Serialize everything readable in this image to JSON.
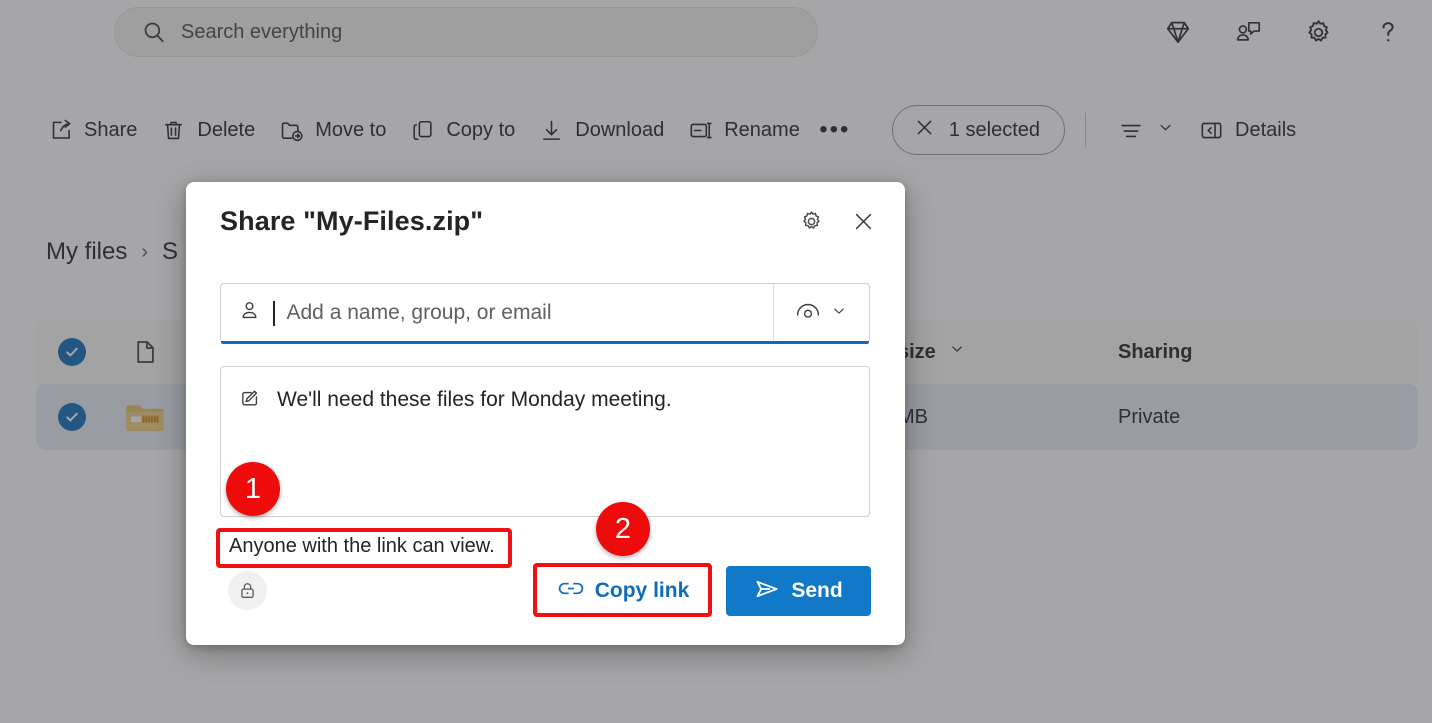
{
  "search": {
    "placeholder": "Search everything",
    "icon": "search-icon"
  },
  "topbar": {
    "icons": [
      {
        "name": "premium-diamond-icon",
        "label": "Premium"
      },
      {
        "name": "feedback-icon",
        "label": "Feedback"
      },
      {
        "name": "settings-gear-icon",
        "label": "Settings"
      },
      {
        "name": "help-question-icon",
        "label": "Help"
      }
    ]
  },
  "toolbar": {
    "commands": [
      {
        "label": "Share",
        "icon": "share-icon"
      },
      {
        "label": "Delete",
        "icon": "trash-icon"
      },
      {
        "label": "Move to",
        "icon": "move-to-folder-icon"
      },
      {
        "label": "Copy to",
        "icon": "copy-to-icon"
      },
      {
        "label": "Download",
        "icon": "download-icon"
      },
      {
        "label": "Rename",
        "icon": "rename-icon"
      }
    ],
    "overflow_label": "•••",
    "selected_label": "1 selected",
    "details_label": "Details",
    "view_icon": "view-options-icon",
    "details_icon": "details-pane-icon"
  },
  "breadcrumb": {
    "items": [
      "My files",
      "S"
    ],
    "separator": "›"
  },
  "file_list": {
    "columns": {
      "name": "",
      "size": "size",
      "sharing": "Sharing"
    },
    "rows": [
      {
        "name": "",
        "size": "MB",
        "sharing": "Private",
        "icon": "zipped-folder-icon",
        "selected": true
      }
    ]
  },
  "dialog": {
    "title": "Share \"My-Files.zip\"",
    "settings_icon": "gear-icon",
    "close_icon": "close-icon",
    "recipient": {
      "placeholder": "Add a name, group, or email",
      "value": "",
      "person_icon": "person-icon",
      "permission_icon": "eye-view-icon",
      "chevron_icon": "chevron-down-icon"
    },
    "message": {
      "value": "We'll need these files for Monday meeting.",
      "icon": "edit-pencil-icon"
    },
    "permission_summary": "Anyone with the link can view.",
    "lock_icon": "lock-icon",
    "copy_link": {
      "label": "Copy link",
      "icon": "link-icon"
    },
    "send": {
      "label": "Send",
      "icon": "send-plane-icon"
    }
  },
  "annotations": {
    "badges": [
      {
        "number": "1"
      },
      {
        "number": "2"
      }
    ],
    "color": "#ee0b0b"
  }
}
